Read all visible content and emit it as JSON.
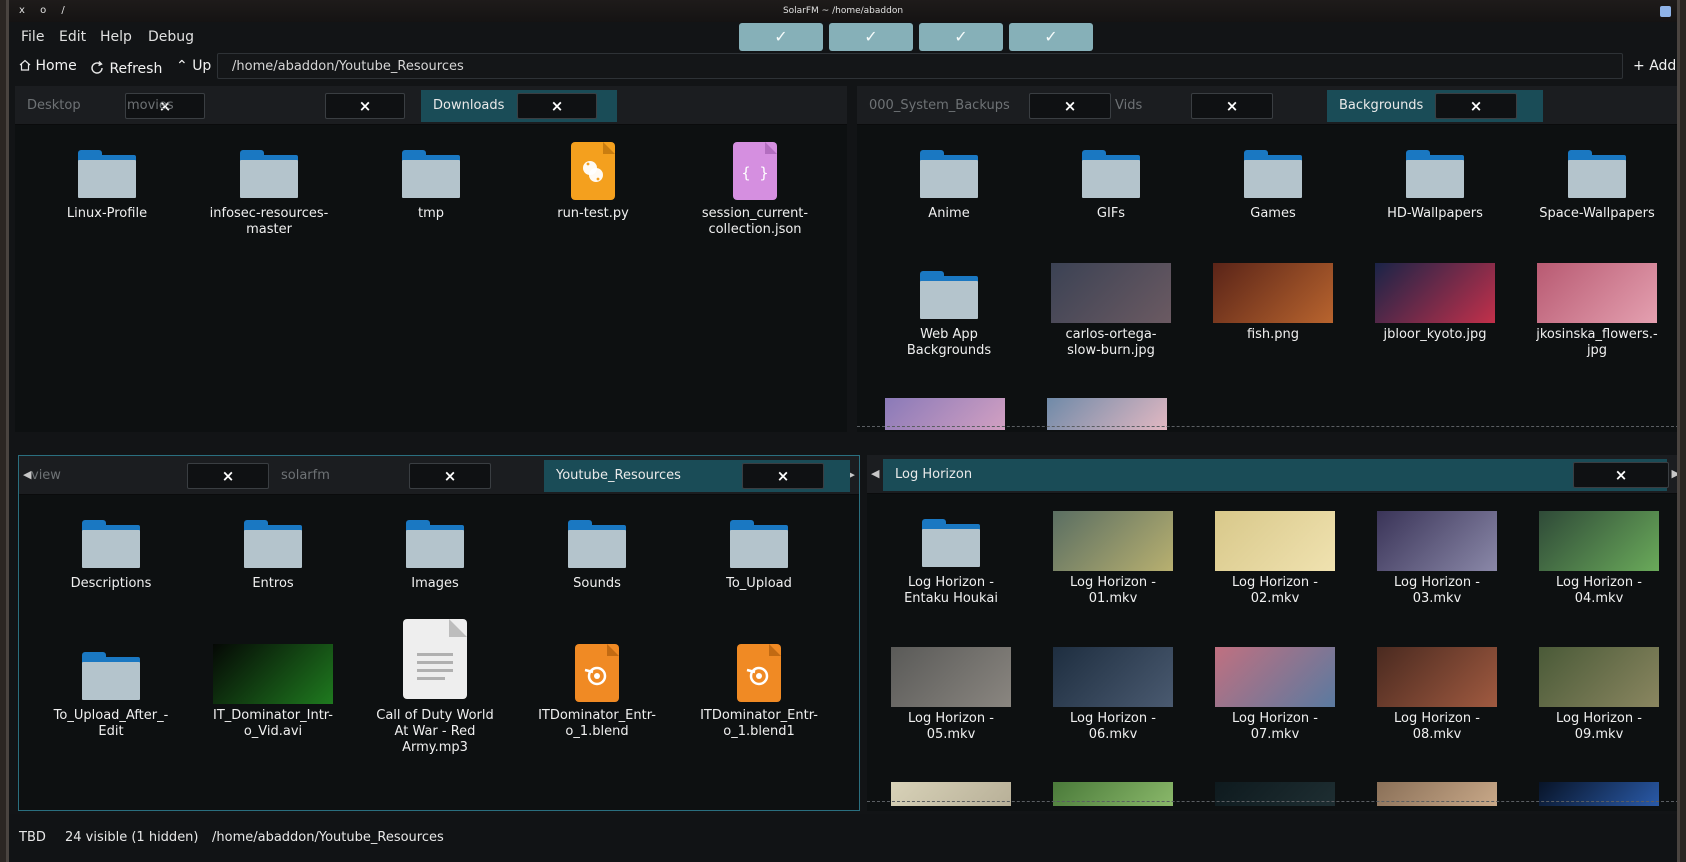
{
  "window": {
    "title": "SolarFM ~ /home/abaddon",
    "controls": "x o /"
  },
  "menu": {
    "file": "File",
    "edit": "Edit",
    "help": "Help",
    "debug": "Debug"
  },
  "view_toggles": [
    "✓",
    "✓",
    "✓",
    "✓"
  ],
  "toolbar": {
    "home": "Home",
    "refresh": "Refresh",
    "up": "Up",
    "path": "/home/abaddon/Youtube_Resources",
    "add": "Add"
  },
  "panes": {
    "top_left": {
      "tabs": [
        {
          "label": "Desktop",
          "close": "×"
        },
        {
          "label": "movies",
          "close": "×"
        },
        {
          "label": "Downloads",
          "close": "×"
        }
      ],
      "items": [
        {
          "name": "Linux-Profile",
          "lines": [
            "Linux-Profile"
          ],
          "icon": "folder-icon"
        },
        {
          "name": "infosec-resources-master",
          "lines": [
            "infosec-resources-",
            "master"
          ],
          "icon": "folder-icon"
        },
        {
          "name": "tmp",
          "lines": [
            "tmp"
          ],
          "icon": "folder-icon"
        },
        {
          "name": "run-test.py",
          "lines": [
            "run-test.py"
          ],
          "icon": "python-file-icon"
        },
        {
          "name": "session_current-collection.json",
          "lines": [
            "session_current-",
            "collection.json"
          ],
          "icon": "json-file-icon"
        }
      ]
    },
    "top_right": {
      "tabs": [
        {
          "label": "000_System_Backups",
          "close": "×"
        },
        {
          "label": "Vids",
          "close": "×"
        },
        {
          "label": "Backgrounds",
          "close": "×"
        }
      ],
      "items": [
        {
          "name": "Anime",
          "lines": [
            "Anime"
          ],
          "icon": "folder-icon"
        },
        {
          "name": "GIFs",
          "lines": [
            "GIFs"
          ],
          "icon": "folder-icon"
        },
        {
          "name": "Games",
          "lines": [
            "Games"
          ],
          "icon": "folder-icon"
        },
        {
          "name": "HD-Wallpapers",
          "lines": [
            "HD-Wallpapers"
          ],
          "icon": "folder-icon"
        },
        {
          "name": "Space-Wallpapers",
          "lines": [
            "Space-Wallpapers"
          ],
          "icon": "folder-icon"
        },
        {
          "name": "Web App Backgrounds",
          "lines": [
            "Web App",
            "Backgrounds"
          ],
          "icon": "folder-icon"
        },
        {
          "name": "carlos-ortega-slow-burn.jpg",
          "lines": [
            "carlos-ortega-",
            "slow-burn.jpg"
          ],
          "icon": "image-thumbnail",
          "colors": [
            "#3b4254",
            "#6b5a62"
          ]
        },
        {
          "name": "fish.png",
          "lines": [
            "fish.png"
          ],
          "icon": "image-thumbnail",
          "colors": [
            "#5a2418",
            "#b8642e"
          ]
        },
        {
          "name": "jbloor_kyoto.jpg",
          "lines": [
            "jbloor_kyoto.jpg"
          ],
          "icon": "image-thumbnail",
          "colors": [
            "#1a2448",
            "#c2304a"
          ]
        },
        {
          "name": "jkosinska_flowers.jpg",
          "lines": [
            "jkosinska_flowers.-",
            "jpg"
          ],
          "icon": "image-thumbnail",
          "colors": [
            "#b85a72",
            "#e4a0b0"
          ]
        }
      ]
    },
    "bottom_left": {
      "tabs": [
        {
          "label": "view",
          "close": "×"
        },
        {
          "label": "solarfm",
          "close": "×"
        },
        {
          "label": "Youtube_Resources",
          "close": "×"
        }
      ],
      "items": [
        {
          "name": "Descriptions",
          "lines": [
            "Descriptions"
          ],
          "icon": "folder-icon"
        },
        {
          "name": "Entros",
          "lines": [
            "Entros"
          ],
          "icon": "folder-icon"
        },
        {
          "name": "Images",
          "lines": [
            "Images"
          ],
          "icon": "folder-icon"
        },
        {
          "name": "Sounds",
          "lines": [
            "Sounds"
          ],
          "icon": "folder-icon"
        },
        {
          "name": "To_Upload",
          "lines": [
            "To_Upload"
          ],
          "icon": "folder-icon"
        },
        {
          "name": "To_Upload_After_-Edit",
          "lines": [
            "To_Upload_After_-",
            "Edit"
          ],
          "icon": "folder-icon"
        },
        {
          "name": "IT_Dominator_Intro_Vid.avi",
          "lines": [
            "IT_Dominator_Intr-",
            "o_Vid.avi"
          ],
          "icon": "video-thumbnail",
          "colors": [
            "#050805",
            "#1f7a1f"
          ]
        },
        {
          "name": "Call of Duty World At War - Red Army.mp3",
          "lines": [
            "Call of Duty World",
            "At War - Red",
            "Army.mp3"
          ],
          "icon": "audio-file-icon"
        },
        {
          "name": "ITDominator_Entro_1.blend",
          "lines": [
            "ITDominator_Entr-",
            "o_1.blend"
          ],
          "icon": "blender-file-icon"
        },
        {
          "name": "ITDominator_Entro_1.blend1",
          "lines": [
            "ITDominator_Entr-",
            "o_1.blend1"
          ],
          "icon": "blender-file-icon"
        }
      ]
    },
    "bottom_right": {
      "tabs": [
        {
          "label": "Log Horizon",
          "close": "×"
        }
      ],
      "items": [
        {
          "name": "Log Horizon - Entaku Houkai",
          "lines": [
            "Log Horizon -",
            "Entaku Houkai"
          ],
          "icon": "folder-icon"
        },
        {
          "name": "Log Horizon - 01.mkv",
          "lines": [
            "Log Horizon -",
            "01.mkv"
          ],
          "icon": "video-thumbnail",
          "colors": [
            "#5a6e62",
            "#b8b070"
          ]
        },
        {
          "name": "Log Horizon - 02.mkv",
          "lines": [
            "Log Horizon -",
            "02.mkv"
          ],
          "icon": "video-thumbnail",
          "colors": [
            "#d8c88a",
            "#f0e2b0"
          ]
        },
        {
          "name": "Log Horizon - 03.mkv",
          "lines": [
            "Log Horizon -",
            "03.mkv"
          ],
          "icon": "video-thumbnail",
          "colors": [
            "#3a3458",
            "#8a88a8"
          ]
        },
        {
          "name": "Log Horizon - 04.mkv",
          "lines": [
            "Log Horizon -",
            "04.mkv"
          ],
          "icon": "video-thumbnail",
          "colors": [
            "#2f4a38",
            "#6aaa5a"
          ]
        },
        {
          "name": "Log Horizon - 05.mkv",
          "lines": [
            "Log Horizon -",
            "05.mkv"
          ],
          "icon": "video-thumbnail",
          "colors": [
            "#5a5a58",
            "#8a8680"
          ]
        },
        {
          "name": "Log Horizon - 06.mkv",
          "lines": [
            "Log Horizon -",
            "06.mkv"
          ],
          "icon": "video-thumbnail",
          "colors": [
            "#1e2e40",
            "#4a5a70"
          ]
        },
        {
          "name": "Log Horizon - 07.mkv",
          "lines": [
            "Log Horizon -",
            "07.mkv"
          ],
          "icon": "video-thumbnail",
          "colors": [
            "#c07080",
            "#5a7aa0"
          ]
        },
        {
          "name": "Log Horizon - 08.mkv",
          "lines": [
            "Log Horizon -",
            "08.mkv"
          ],
          "icon": "video-thumbnail",
          "colors": [
            "#4a2a20",
            "#a05a40"
          ]
        },
        {
          "name": "Log Horizon - 09.mkv",
          "lines": [
            "Log Horizon -",
            "09.mkv"
          ],
          "icon": "video-thumbnail",
          "colors": [
            "#4a5a38",
            "#8a8660"
          ]
        }
      ]
    }
  },
  "status": {
    "mode": "TBD",
    "visible": "24 visible (1 hidden)",
    "path": "/home/abaddon/Youtube_Resources"
  }
}
